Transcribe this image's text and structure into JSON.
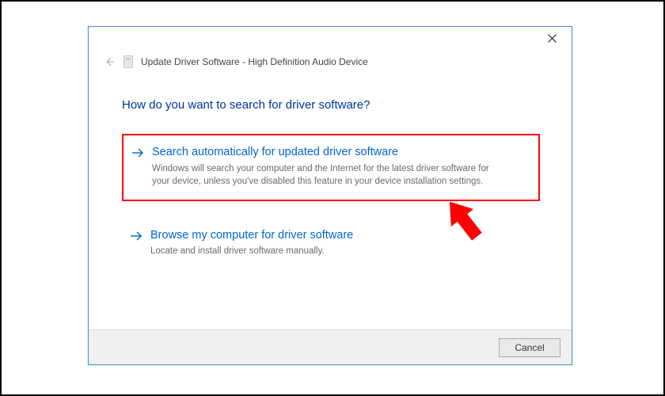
{
  "header": {
    "title": "Update Driver Software - High Definition Audio Device"
  },
  "heading": "How do you want to search for driver software?",
  "options": [
    {
      "title": "Search automatically for updated driver software",
      "desc": "Windows will search your computer and the Internet for the latest driver software for your device, unless you've disabled this feature in your device installation settings."
    },
    {
      "title": "Browse my computer for driver software",
      "desc": "Locate and install driver software manually."
    }
  ],
  "footer": {
    "cancel_label": "Cancel"
  }
}
